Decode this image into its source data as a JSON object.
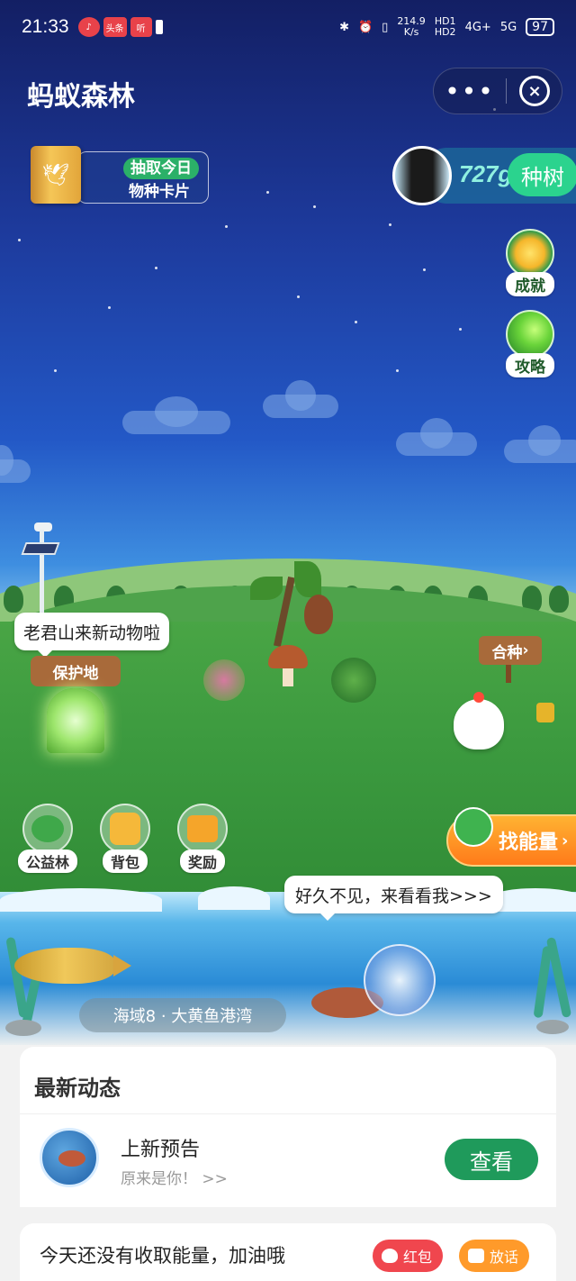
{
  "status_bar": {
    "time": "21:33",
    "app_badges": [
      "头条",
      "听"
    ],
    "net_speed": "214.9",
    "net_unit": "K/s",
    "hd1": "HD1",
    "hd2": "HD2",
    "net1": "4G+",
    "net2": "5G",
    "battery": "97"
  },
  "header": {
    "title": "蚂蚁森林",
    "more_label": "•••",
    "close_label": "×"
  },
  "species_card": {
    "line1": "抽取今日",
    "line2": "物种卡片"
  },
  "energy": {
    "amount": "727g",
    "plant_label": "种树"
  },
  "side_buttons": [
    {
      "label": "成就",
      "icon": "sprout-medal-icon"
    },
    {
      "label": "攻略",
      "icon": "green-orb-icon"
    }
  ],
  "scene": {
    "gate_bubble": "老君山来新动物啦",
    "gate_sign": "保护地",
    "sign_post": "合种",
    "sign_post_arrow": "›"
  },
  "bottom_buttons": [
    {
      "label": "公益林",
      "icon": "tree-icon"
    },
    {
      "label": "背包",
      "icon": "backpack-icon"
    },
    {
      "label": "奖励",
      "icon": "gift-box-icon"
    }
  ],
  "find_energy": {
    "label": "找能量",
    "arrow": "›"
  },
  "sea": {
    "bubble": "好久不见，来看看我>>>",
    "area_label": "海域8 · 大黄鱼港湾"
  },
  "feed": {
    "title": "最新动态",
    "item_title": "上新预告",
    "item_sub": "原来是你！ >>",
    "view_label": "查看"
  },
  "bottom": {
    "message": "今天还没有收取能量，加油哦",
    "red_packet_label": "红包",
    "chat_label": "放话"
  },
  "colors": {
    "primary_green": "#1f9a5b",
    "orange": "#ff7a1a",
    "red": "#f0464e"
  }
}
